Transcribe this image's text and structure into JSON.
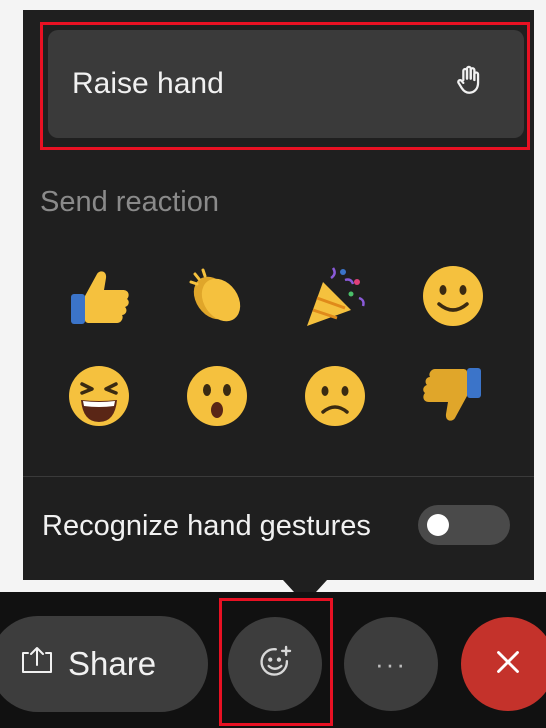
{
  "raise_hand": {
    "label": "Raise hand",
    "icon": "hand-raise-icon"
  },
  "reactions": {
    "title": "Send reaction",
    "items": [
      {
        "name": "like",
        "icon": "thumbs-up-icon"
      },
      {
        "name": "applause",
        "icon": "clapping-hands-icon"
      },
      {
        "name": "celebrate",
        "icon": "party-popper-icon"
      },
      {
        "name": "smile",
        "icon": "smile-icon"
      },
      {
        "name": "laugh",
        "icon": "laughing-icon"
      },
      {
        "name": "surprised",
        "icon": "surprised-icon"
      },
      {
        "name": "sad",
        "icon": "sad-icon"
      },
      {
        "name": "dislike",
        "icon": "thumbs-down-icon"
      }
    ]
  },
  "gestures": {
    "label": "Recognize hand gestures",
    "toggle_on": false
  },
  "toolbar": {
    "share_label": "Share",
    "react_icon": "emoji-reaction-icon",
    "more_label": "···",
    "leave_icon": "close-icon"
  },
  "colors": {
    "highlight": "#e81123",
    "leave": "#c4322b",
    "panel": "#1f1f1f",
    "emoji": "#f5c13e"
  }
}
